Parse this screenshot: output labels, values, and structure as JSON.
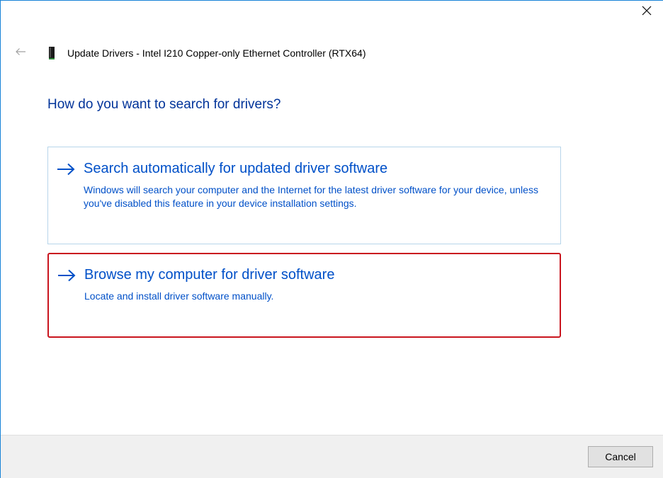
{
  "window": {
    "title": "Update Drivers - Intel I210 Copper-only Ethernet Controller (RTX64)",
    "icons": {
      "close": "close-icon",
      "back": "back-arrow-icon",
      "device": "network-adapter-icon"
    }
  },
  "main": {
    "heading": "How do you want to search for drivers?",
    "options": [
      {
        "title": "Search automatically for updated driver software",
        "description": "Windows will search your computer and the Internet for the latest driver software for your device, unless you've disabled this feature in your device installation settings.",
        "icon": "arrow-right-icon",
        "selected": false
      },
      {
        "title": "Browse my computer for driver software",
        "description": "Locate and install driver software manually.",
        "icon": "arrow-right-icon",
        "selected": true
      }
    ]
  },
  "footer": {
    "cancel_label": "Cancel"
  },
  "colors": {
    "accent_blue": "#0050c8",
    "heading_blue": "#003399",
    "selected_border": "#c9151e",
    "option_border": "#b7d5ea",
    "footer_bg": "#f0f0f0"
  }
}
